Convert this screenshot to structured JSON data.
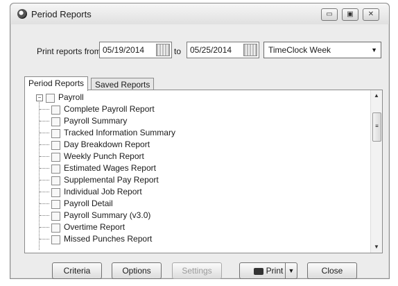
{
  "window": {
    "title": "Period Reports",
    "controls": [
      "minimize",
      "maximize",
      "close"
    ]
  },
  "filters": {
    "print_from_label": "Print reports from",
    "start_date": "05/19/2014",
    "to_label": "to",
    "end_date": "05/25/2014",
    "period_select": "TimeClock Week"
  },
  "tabs": [
    {
      "label": "Period Reports",
      "active": true
    },
    {
      "label": "Saved Reports",
      "active": false
    }
  ],
  "tree": {
    "root": "Payroll",
    "items": [
      "Complete Payroll Report",
      "Payroll Summary",
      "Tracked Information Summary",
      "Day Breakdown Report",
      "Weekly Punch Report",
      "Estimated Wages Report",
      "Supplemental Pay Report",
      "Individual Job Report",
      "Payroll Detail",
      "Payroll Summary (v3.0)",
      "Overtime Report",
      "Missed Punches Report"
    ]
  },
  "buttons": {
    "criteria": "Criteria",
    "options": "Options",
    "settings": "Settings",
    "print": "Print",
    "close": "Close"
  },
  "icons": {
    "app": "clock-icon",
    "calendar": "calendar-icon",
    "printer": "printer-icon"
  }
}
